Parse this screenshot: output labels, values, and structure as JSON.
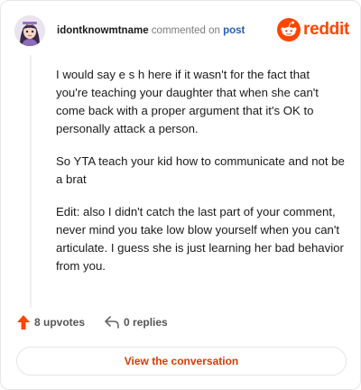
{
  "comment": {
    "username": "idontknowmtname",
    "action_text": "commented on",
    "target_link": "post",
    "paragraphs": [
      "I would say e s h here if it wasn't for the fact that you're teaching your daughter that when she can't come back with a proper argument that it's OK to personally attack a person.",
      "So YTA teach your kid how to communicate and not be a brat",
      "Edit: also I didn't catch the last part of your comment, never mind you take low blow yourself when you can't articulate. I guess she is just learning her bad behavior from you."
    ]
  },
  "brand": {
    "wordmark": "reddit",
    "color": "#ff4500"
  },
  "actions": {
    "upvotes_label": "8 upvotes",
    "replies_label": "0 replies",
    "upvote_icon": "upvote-arrow-icon",
    "reply_icon": "reply-arrow-icon",
    "upvote_color": "#ff4500"
  },
  "footer": {
    "button_label": "View the conversation",
    "button_color": "#d93a00"
  }
}
